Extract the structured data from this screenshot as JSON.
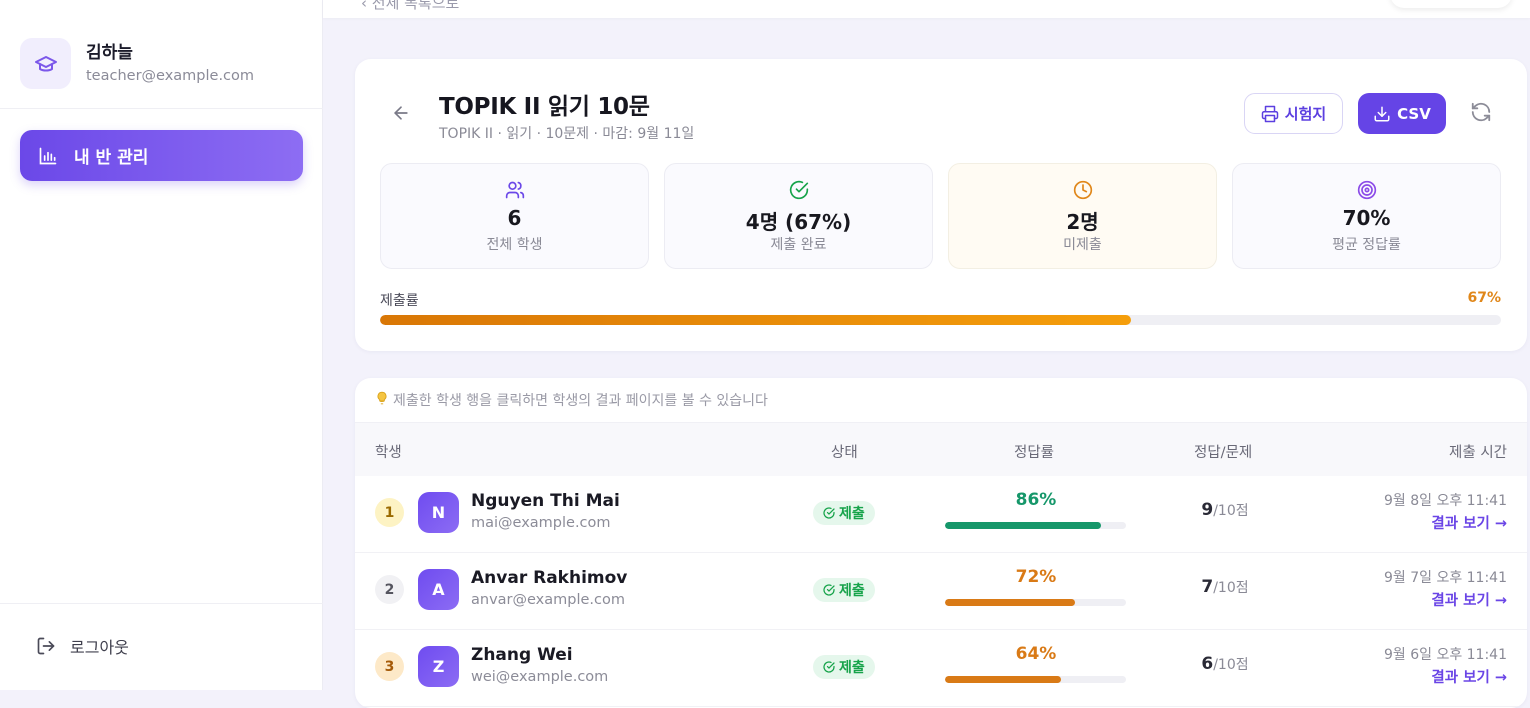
{
  "sidebar": {
    "profile": {
      "name": "김하늘",
      "email": "teacher@example.com"
    },
    "nav": [
      {
        "label": "내 반 관리",
        "icon": "bar-chart-icon",
        "active": true
      }
    ],
    "logout_label": "로그아웃"
  },
  "topbar": {
    "crumb": "‹ 전체 목록으로"
  },
  "exam": {
    "title": "TOPIK II 읽기 10문",
    "subtitle": "TOPIK II · 읽기 · 10문제 · 마감: 9월 11일",
    "print_label": "시험지",
    "csv_label": "CSV"
  },
  "stats": [
    {
      "value": "6",
      "label": "전체 학생",
      "icon": "users-icon",
      "color": "#6b48e8"
    },
    {
      "value": "4명 (67%)",
      "label": "제출 완료",
      "icon": "check-circle-icon",
      "color": "#16a34a"
    },
    {
      "value": "2명",
      "label": "미제출",
      "icon": "clock-icon",
      "color": "#e0871a"
    },
    {
      "value": "70%",
      "label": "평균 정답률",
      "icon": "target-icon",
      "color": "#8b4be8"
    }
  ],
  "submission_rate": {
    "label": "제출률",
    "percent_text": "67%",
    "fraction": 0.67
  },
  "table": {
    "hint": "제출한 학생 행을 클릭하면 학생의 결과 페이지를 볼 수 있습니다",
    "columns": [
      "학생",
      "상태",
      "정답률",
      "정답/문제",
      "제출 시간"
    ],
    "rows": [
      {
        "rank": "1",
        "initial": "N",
        "name": "Nguyen Thi Mai",
        "email": "mai@example.com",
        "status": "제출",
        "score": "86%",
        "score_fraction": 0.86,
        "score_color": "#16976a",
        "correct": "9",
        "total": "/10점",
        "time": "9월 8일 오후 11:41",
        "link": "결과 보기 →"
      },
      {
        "rank": "2",
        "initial": "A",
        "name": "Anvar Rakhimov",
        "email": "anvar@example.com",
        "status": "제출",
        "score": "72%",
        "score_fraction": 0.72,
        "score_color": "#d97a16",
        "correct": "7",
        "total": "/10점",
        "time": "9월 7일 오후 11:41",
        "link": "결과 보기 →"
      },
      {
        "rank": "3",
        "initial": "Z",
        "name": "Zhang Wei",
        "email": "wei@example.com",
        "status": "제출",
        "score": "64%",
        "score_fraction": 0.64,
        "score_color": "#d97a16",
        "correct": "6",
        "total": "/10점",
        "time": "9월 6일 오후 11:41",
        "link": "결과 보기 →"
      }
    ]
  }
}
